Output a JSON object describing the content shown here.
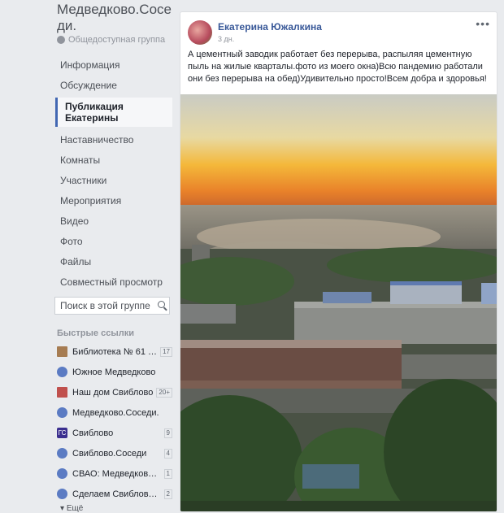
{
  "group": {
    "title": "Медведково.Соседи.",
    "type": "Общедоступная группа"
  },
  "nav": [
    {
      "label": "Информация"
    },
    {
      "label": "Обсуждение"
    },
    {
      "label": "Публикация Екатерины"
    },
    {
      "label": "Наставничество"
    },
    {
      "label": "Комнаты"
    },
    {
      "label": "Участники"
    },
    {
      "label": "Мероприятия"
    },
    {
      "label": "Видео"
    },
    {
      "label": "Фото"
    },
    {
      "label": "Файлы"
    },
    {
      "label": "Совместный просмотр"
    }
  ],
  "search": {
    "placeholder": "Поиск в этой группе"
  },
  "quick_links": {
    "heading": "Быстрые ссылки",
    "items": [
      {
        "label": "Библиотека № 61 н...",
        "count": "17",
        "icon": "book-icon"
      },
      {
        "label": "Южное Медведково",
        "count": "",
        "icon": "group-icon"
      },
      {
        "label": "Наш дом Свиблово",
        "count": "20+",
        "icon": "house-icon"
      },
      {
        "label": "Медведково.Соседи.",
        "count": "",
        "icon": "group-icon"
      },
      {
        "label": "Свиблово",
        "count": "9",
        "icon": "gc-icon"
      },
      {
        "label": "Свиблово.Соседи",
        "count": "4",
        "icon": "group-icon"
      },
      {
        "label": "СВАО: Медведково,...",
        "count": "1",
        "icon": "group-icon"
      },
      {
        "label": "Сделаем Свиблово ...",
        "count": "2",
        "icon": "group-icon"
      }
    ],
    "more": "Ещё"
  },
  "post": {
    "author": "Екатерина Южалкина",
    "time": "3 дн.",
    "text": "А цементный заводик работает без перерыва, распыляя цементную пыль на жилые кварталы.фото из моего окна)Всю пандемию работали они без перерыва на обед)Удивительно просто!Всем добра и здоровья!",
    "more_icon": "more-dots-icon"
  }
}
